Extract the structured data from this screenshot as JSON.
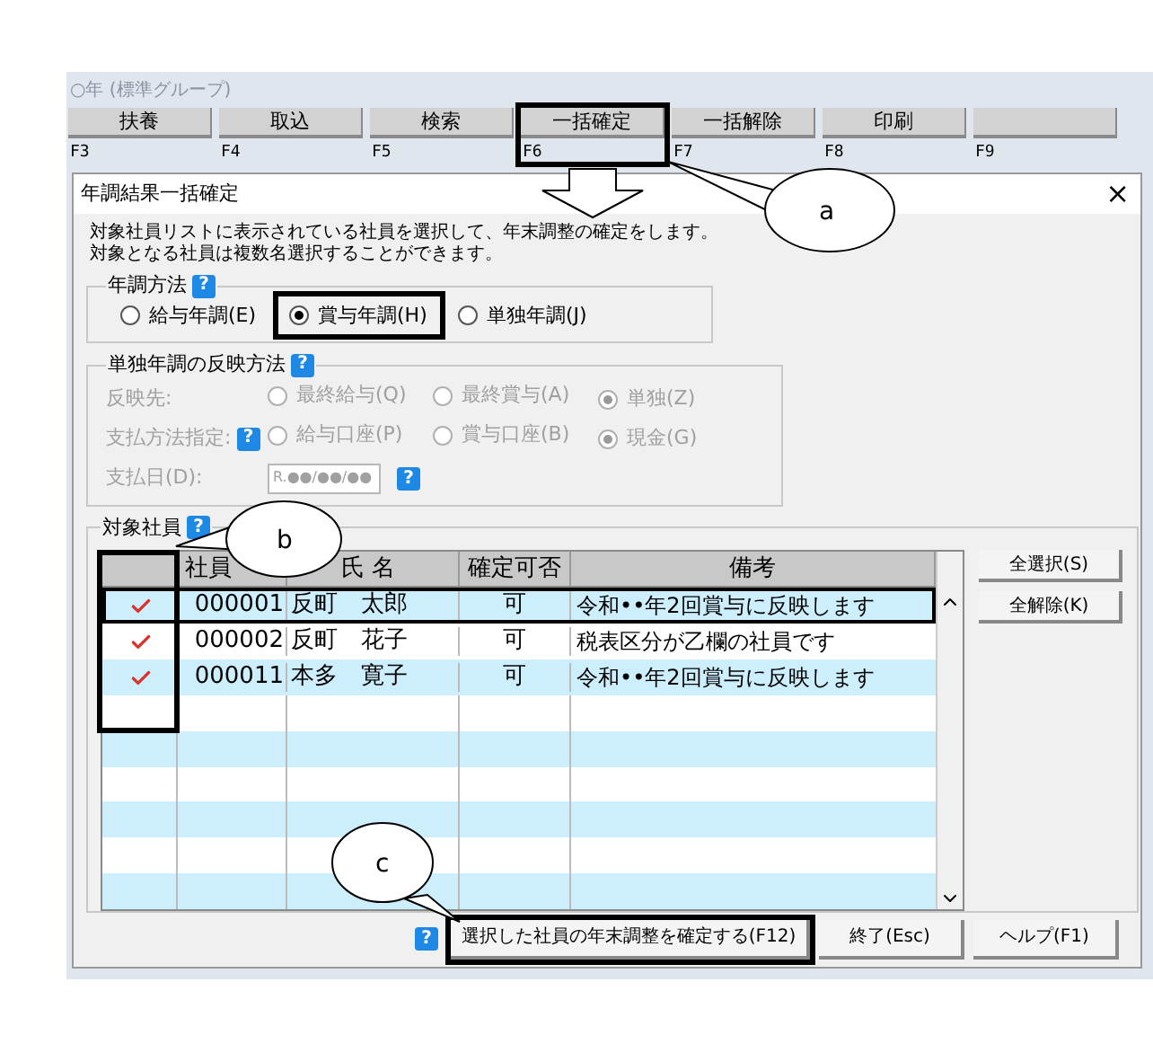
{
  "background_window": {
    "title": "○年 (標準グループ)"
  },
  "toolbar": [
    {
      "label": "扶養",
      "key": "F3"
    },
    {
      "label": "取込",
      "key": "F4"
    },
    {
      "label": "検索",
      "key": "F5"
    },
    {
      "label": "一括確定",
      "key": "F6"
    },
    {
      "label": "一括解除",
      "key": "F7"
    },
    {
      "label": "印刷",
      "key": "F8"
    },
    {
      "key": "F9"
    }
  ],
  "dialog": {
    "title": "年調結果一括確定",
    "close": "×",
    "description": [
      "対象社員リストに表示されている社員を選択して、年末調整の確定をします。",
      "対象となる社員は複数名選択することができます。"
    ],
    "method": {
      "legend": "年調方法",
      "help": "?",
      "options": [
        {
          "label": "給与年調(E)",
          "selected": false
        },
        {
          "label": "賞与年調(H)",
          "selected": true
        },
        {
          "label": "単独年調(J)",
          "selected": false
        }
      ]
    },
    "standalone": {
      "legend": "単独年調の反映方法",
      "help": "?",
      "disabled": true,
      "rows": [
        {
          "kind": "radios",
          "label": "反映先:",
          "options": [
            {
              "label": "最終給与(Q)",
              "selected": false
            },
            {
              "label": "最終賞与(A)",
              "selected": false
            },
            {
              "label": "単独(Z)",
              "selected": true
            }
          ]
        },
        {
          "kind": "radios",
          "label": "支払方法指定:",
          "help": "?",
          "options": [
            {
              "label": "給与口座(P)",
              "selected": false
            },
            {
              "label": "賞与口座(B)",
              "selected": false
            },
            {
              "label": "現金(G)",
              "selected": true
            }
          ]
        },
        {
          "kind": "date",
          "label": "支払日(D):",
          "value": "R.●●/●●/●●",
          "help": "?"
        }
      ]
    },
    "employees": {
      "legend": "対象社員",
      "help": "?",
      "columns": [
        "社員",
        "氏 名",
        "確定可否",
        "備考"
      ],
      "rows": [
        {
          "checked": true,
          "selected": true,
          "code": "000001",
          "name": "反町　太郎",
          "status": "可",
          "note": "令和••年2回賞与に反映します"
        },
        {
          "checked": true,
          "selected": false,
          "code": "000002",
          "name": "反町　花子",
          "status": "可",
          "note": "税表区分が乙欄の社員です"
        },
        {
          "checked": true,
          "selected": false,
          "code": "000011",
          "name": "本多　寛子",
          "status": "可",
          "note": "令和••年2回賞与に反映します"
        }
      ],
      "side_buttons": [
        "全選択(S)",
        "全解除(K)"
      ]
    },
    "footer": {
      "help": "?",
      "buttons": [
        "選択した社員の年末調整を確定する(F12)",
        "終了(Esc)",
        "ヘルプ(F1)"
      ]
    }
  },
  "annotations": [
    {
      "label": "a"
    },
    {
      "label": "b"
    },
    {
      "label": "c"
    }
  ]
}
